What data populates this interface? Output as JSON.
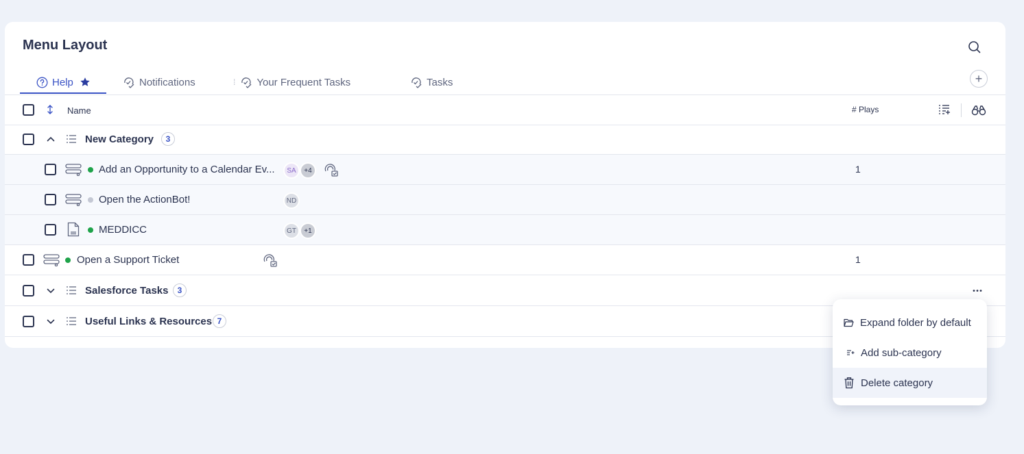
{
  "page": {
    "title": "Menu Layout"
  },
  "tabs": [
    {
      "label": "Help",
      "active": true
    },
    {
      "label": "Notifications"
    },
    {
      "label": "Your Frequent Tasks"
    },
    {
      "label": "Tasks"
    }
  ],
  "table": {
    "columns": {
      "name": "Name",
      "plays": "# Plays"
    },
    "rows": [
      {
        "type": "category",
        "label": "New Category",
        "count": "3",
        "expanded": true
      },
      {
        "type": "flow",
        "label": "Add an Opportunity to a Calendar Ev...",
        "status": "live",
        "avatars": [
          "SA",
          "+4"
        ],
        "plays": "1"
      },
      {
        "type": "flow",
        "label": "Open the ActionBot!",
        "status": "draft",
        "avatars": [
          "ND"
        ],
        "plays": ""
      },
      {
        "type": "article",
        "label": "MEDDICC",
        "status": "live",
        "avatars": [
          "GT",
          "+1"
        ],
        "plays": ""
      },
      {
        "type": "flow",
        "label": "Open a Support Ticket",
        "status": "live",
        "avatars": [],
        "plays": "1"
      },
      {
        "type": "category",
        "label": "Salesforce Tasks",
        "count": "3",
        "expanded": false
      },
      {
        "type": "category",
        "label": "Useful Links & Resources",
        "count": "7",
        "expanded": false
      }
    ]
  },
  "context_menu": {
    "items": [
      {
        "label": "Expand folder by default",
        "icon": "folder-open-icon"
      },
      {
        "label": "Add sub-category",
        "icon": "add-sub-category-icon"
      },
      {
        "label": "Delete category",
        "icon": "trash-icon"
      }
    ]
  },
  "colors": {
    "accent": "#3a53c5",
    "live": "#1fa34a",
    "draft": "#c4c8d4",
    "background": "#eef2f9"
  }
}
